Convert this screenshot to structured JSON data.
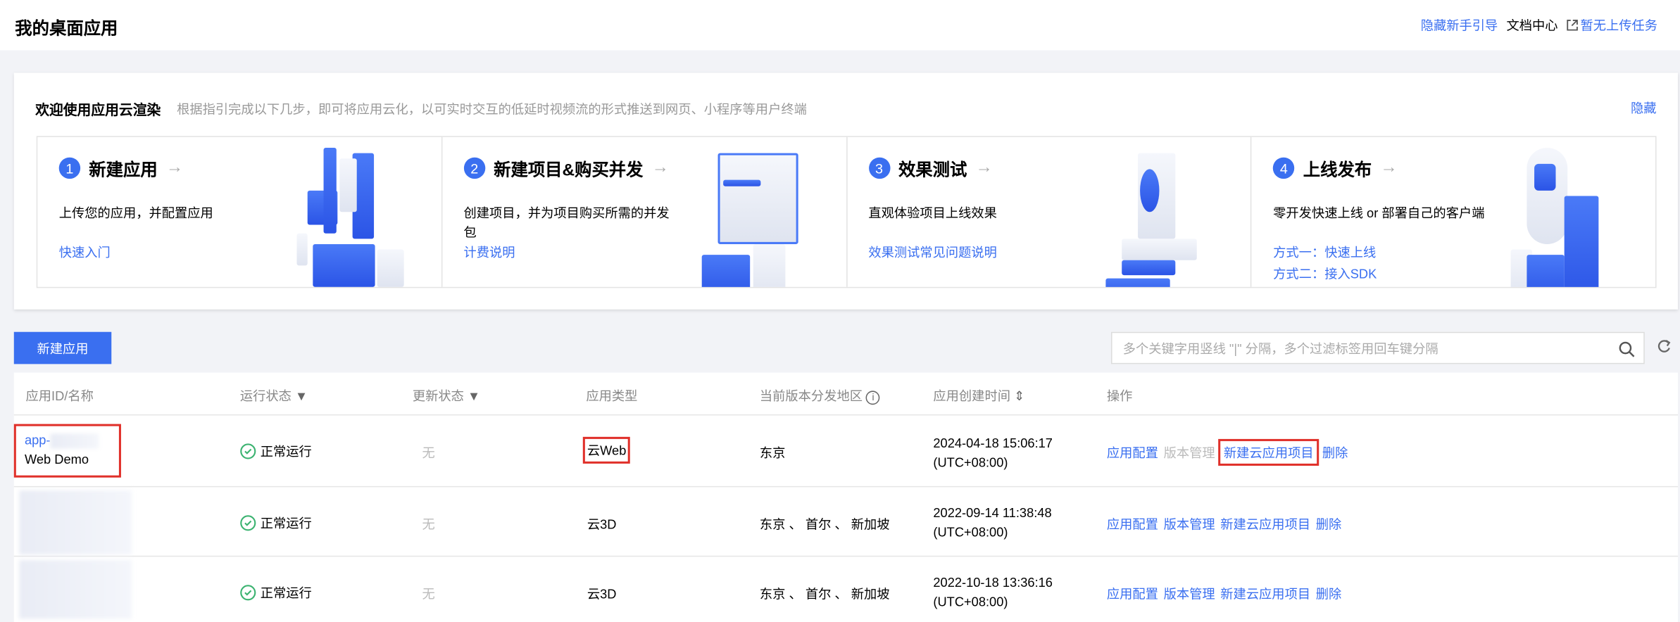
{
  "header": {
    "title": "我的桌面应用",
    "hide_guide": "隐藏新手引导",
    "docs": "文档中心",
    "upload_tasks": "暂无上传任务"
  },
  "guide": {
    "title": "欢迎使用应用云渲染",
    "subtitle": "根据指引完成以下几步，即可将应用云化，以可实时交互的低延时视频流的形式推送到网页、小程序等用户终端",
    "hide": "隐藏",
    "steps": [
      {
        "num": "1",
        "title": "新建应用",
        "desc": "上传您的应用，并配置应用",
        "links": [
          "快速入门"
        ]
      },
      {
        "num": "2",
        "title": "新建项目&购买并发",
        "desc": "创建项目，并为项目购买所需的并发包",
        "links": [
          "计费说明"
        ]
      },
      {
        "num": "3",
        "title": "效果测试",
        "desc": "直观体验项目上线效果",
        "links": [
          "效果测试常见问题说明"
        ]
      },
      {
        "num": "4",
        "title": "上线发布",
        "desc": "零开发快速上线 or 部署自己的客户端",
        "links": [
          "方式一：快速上线",
          "方式二：接入SDK"
        ]
      }
    ]
  },
  "toolbar": {
    "new_app": "新建应用",
    "search_placeholder": "多个关键字用竖线 \"|\" 分隔，多个过滤标签用回车键分隔"
  },
  "table": {
    "columns": [
      "应用ID/名称",
      "运行状态",
      "更新状态",
      "应用类型",
      "当前版本分发地区",
      "应用创建时间",
      "操作"
    ],
    "rows": [
      {
        "id": "app-",
        "name": "Web Demo",
        "status": "正常运行",
        "update": "无",
        "type": "云Web",
        "region": "东京",
        "created": "2024-04-18 15:06:17",
        "tz": "(UTC+08:00)",
        "actions": [
          "应用配置",
          "版本管理",
          "新建云应用项目",
          "删除"
        ]
      },
      {
        "id": "",
        "name": "",
        "status": "正常运行",
        "update": "无",
        "type": "云3D",
        "region": "东京 、 首尔 、 新加坡",
        "created": "2022-09-14 11:38:48",
        "tz": "(UTC+08:00)",
        "actions": [
          "应用配置",
          "版本管理",
          "新建云应用项目",
          "删除"
        ]
      },
      {
        "id": "",
        "name": "",
        "status": "正常运行",
        "update": "无",
        "type": "云3D",
        "region": "东京 、 首尔 、 新加坡",
        "created": "2022-10-18 13:36:16",
        "tz": "(UTC+08:00)",
        "actions": [
          "应用配置",
          "版本管理",
          "新建云应用项目",
          "删除"
        ]
      }
    ]
  },
  "colors": {
    "accent": "#3a6ff0",
    "success": "#3cb371",
    "highlight": "#e0302a"
  }
}
